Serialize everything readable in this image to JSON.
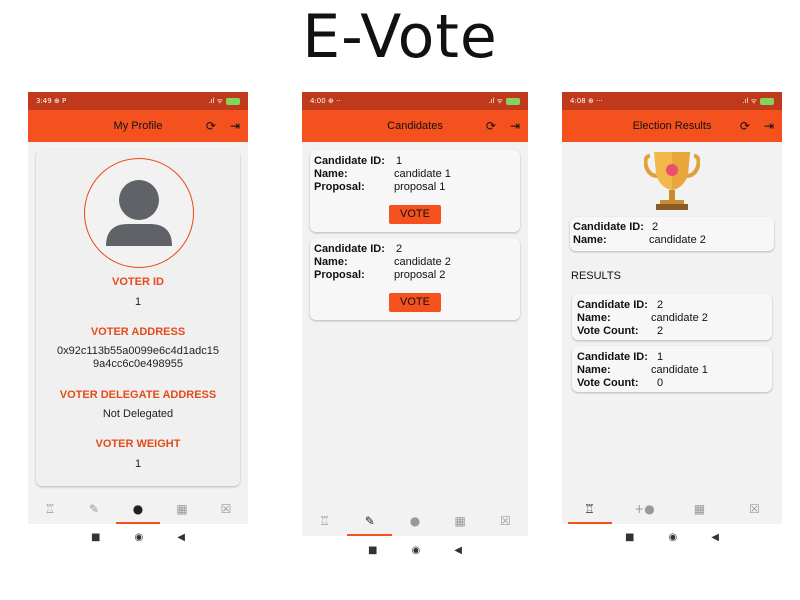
{
  "page_title": "E-Vote",
  "system_nav": {
    "back": "◀",
    "home": "◉",
    "recent": "■"
  },
  "screens": {
    "profile": {
      "time": "3:49",
      "status_icons": "⊕ P",
      "signal": ".ıl ᯤ",
      "title": "My Profile",
      "voter_id_label": "VOTER ID",
      "voter_id": "1",
      "address_label": "VOTER ADDRESS",
      "address_line1": "0x92c113b55a0099e6c4d1adc15",
      "address_line2": "9a4cc6c0e498955",
      "delegate_label": "VOTER DELEGATE ADDRESS",
      "delegate_value": "Not Delegated",
      "weight_label": "VOTER WEIGHT",
      "weight_value": "1"
    },
    "candidates": {
      "time": "4:00",
      "status_icons": "⊕ ··",
      "signal": ".ıl ᯤ",
      "title": "Candidates",
      "id_label": "Candidate ID:",
      "name_label": "Name:",
      "proposal_label": "Proposal:",
      "vote_label": "VOTE",
      "items": [
        {
          "id": "1",
          "name": "candidate 1",
          "proposal": "proposal 1"
        },
        {
          "id": "2",
          "name": "candidate 2",
          "proposal": "proposal 2"
        }
      ]
    },
    "results": {
      "time": "4:08",
      "status_icons": "⊕ ···",
      "signal": ".ıl ᯤ",
      "title": "Election Results",
      "winner": {
        "id": "2",
        "name": "candidate 2"
      },
      "results_heading": "RESULTS",
      "id_label": "Candidate ID:",
      "name_label": "Name:",
      "count_label": "Vote Count:",
      "items": [
        {
          "id": "2",
          "name": "candidate 2",
          "count": "2"
        },
        {
          "id": "1",
          "name": "candidate 1",
          "count": "0"
        }
      ]
    }
  },
  "colors": {
    "status_bar": "#c0391b",
    "app_bar": "#f4511e",
    "accent": "#e64a19",
    "trophy": "#f2b84b"
  },
  "icons": [
    "refresh-icon",
    "logout-icon",
    "results-nav-icon",
    "vote-nav-icon",
    "profile-nav-icon",
    "dashboard-nav-icon",
    "ballot-nav-icon",
    "trophy-icon",
    "avatar-icon",
    "add-voter-nav-icon"
  ]
}
